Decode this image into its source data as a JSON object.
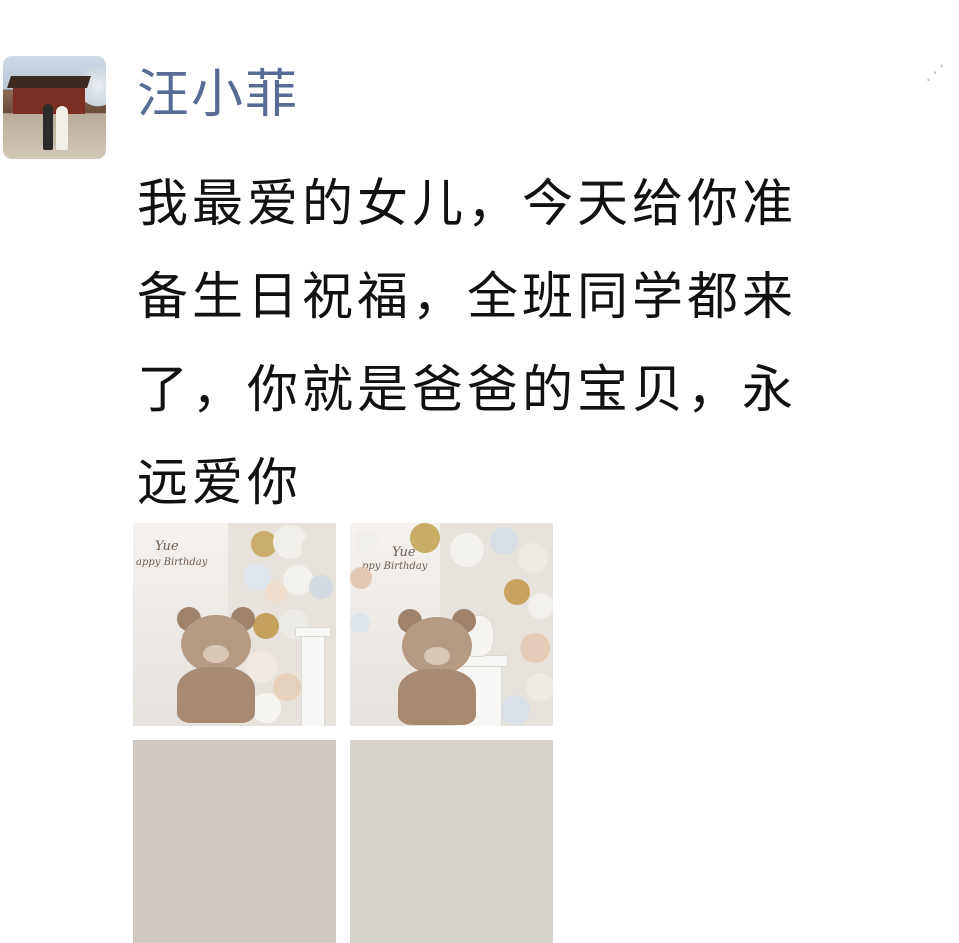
{
  "post": {
    "username": "汪小菲",
    "message_lines": [
      "我最爱的女儿，今天给你准",
      "备生日祝福，全班同学都来",
      "了，你就是爸爸的宝贝，永",
      "远爱你"
    ]
  },
  "photos": {
    "items": [
      {
        "script_name": "Yue",
        "script_text": "appy Birthday"
      },
      {
        "script_name": "Yue",
        "script_text": "ppy Birthday"
      }
    ]
  },
  "icons": {
    "avatar": "avatar-photo",
    "more": "more-icon"
  },
  "colors": {
    "username": "#576b95",
    "text": "#111111",
    "background": "#ffffff"
  }
}
